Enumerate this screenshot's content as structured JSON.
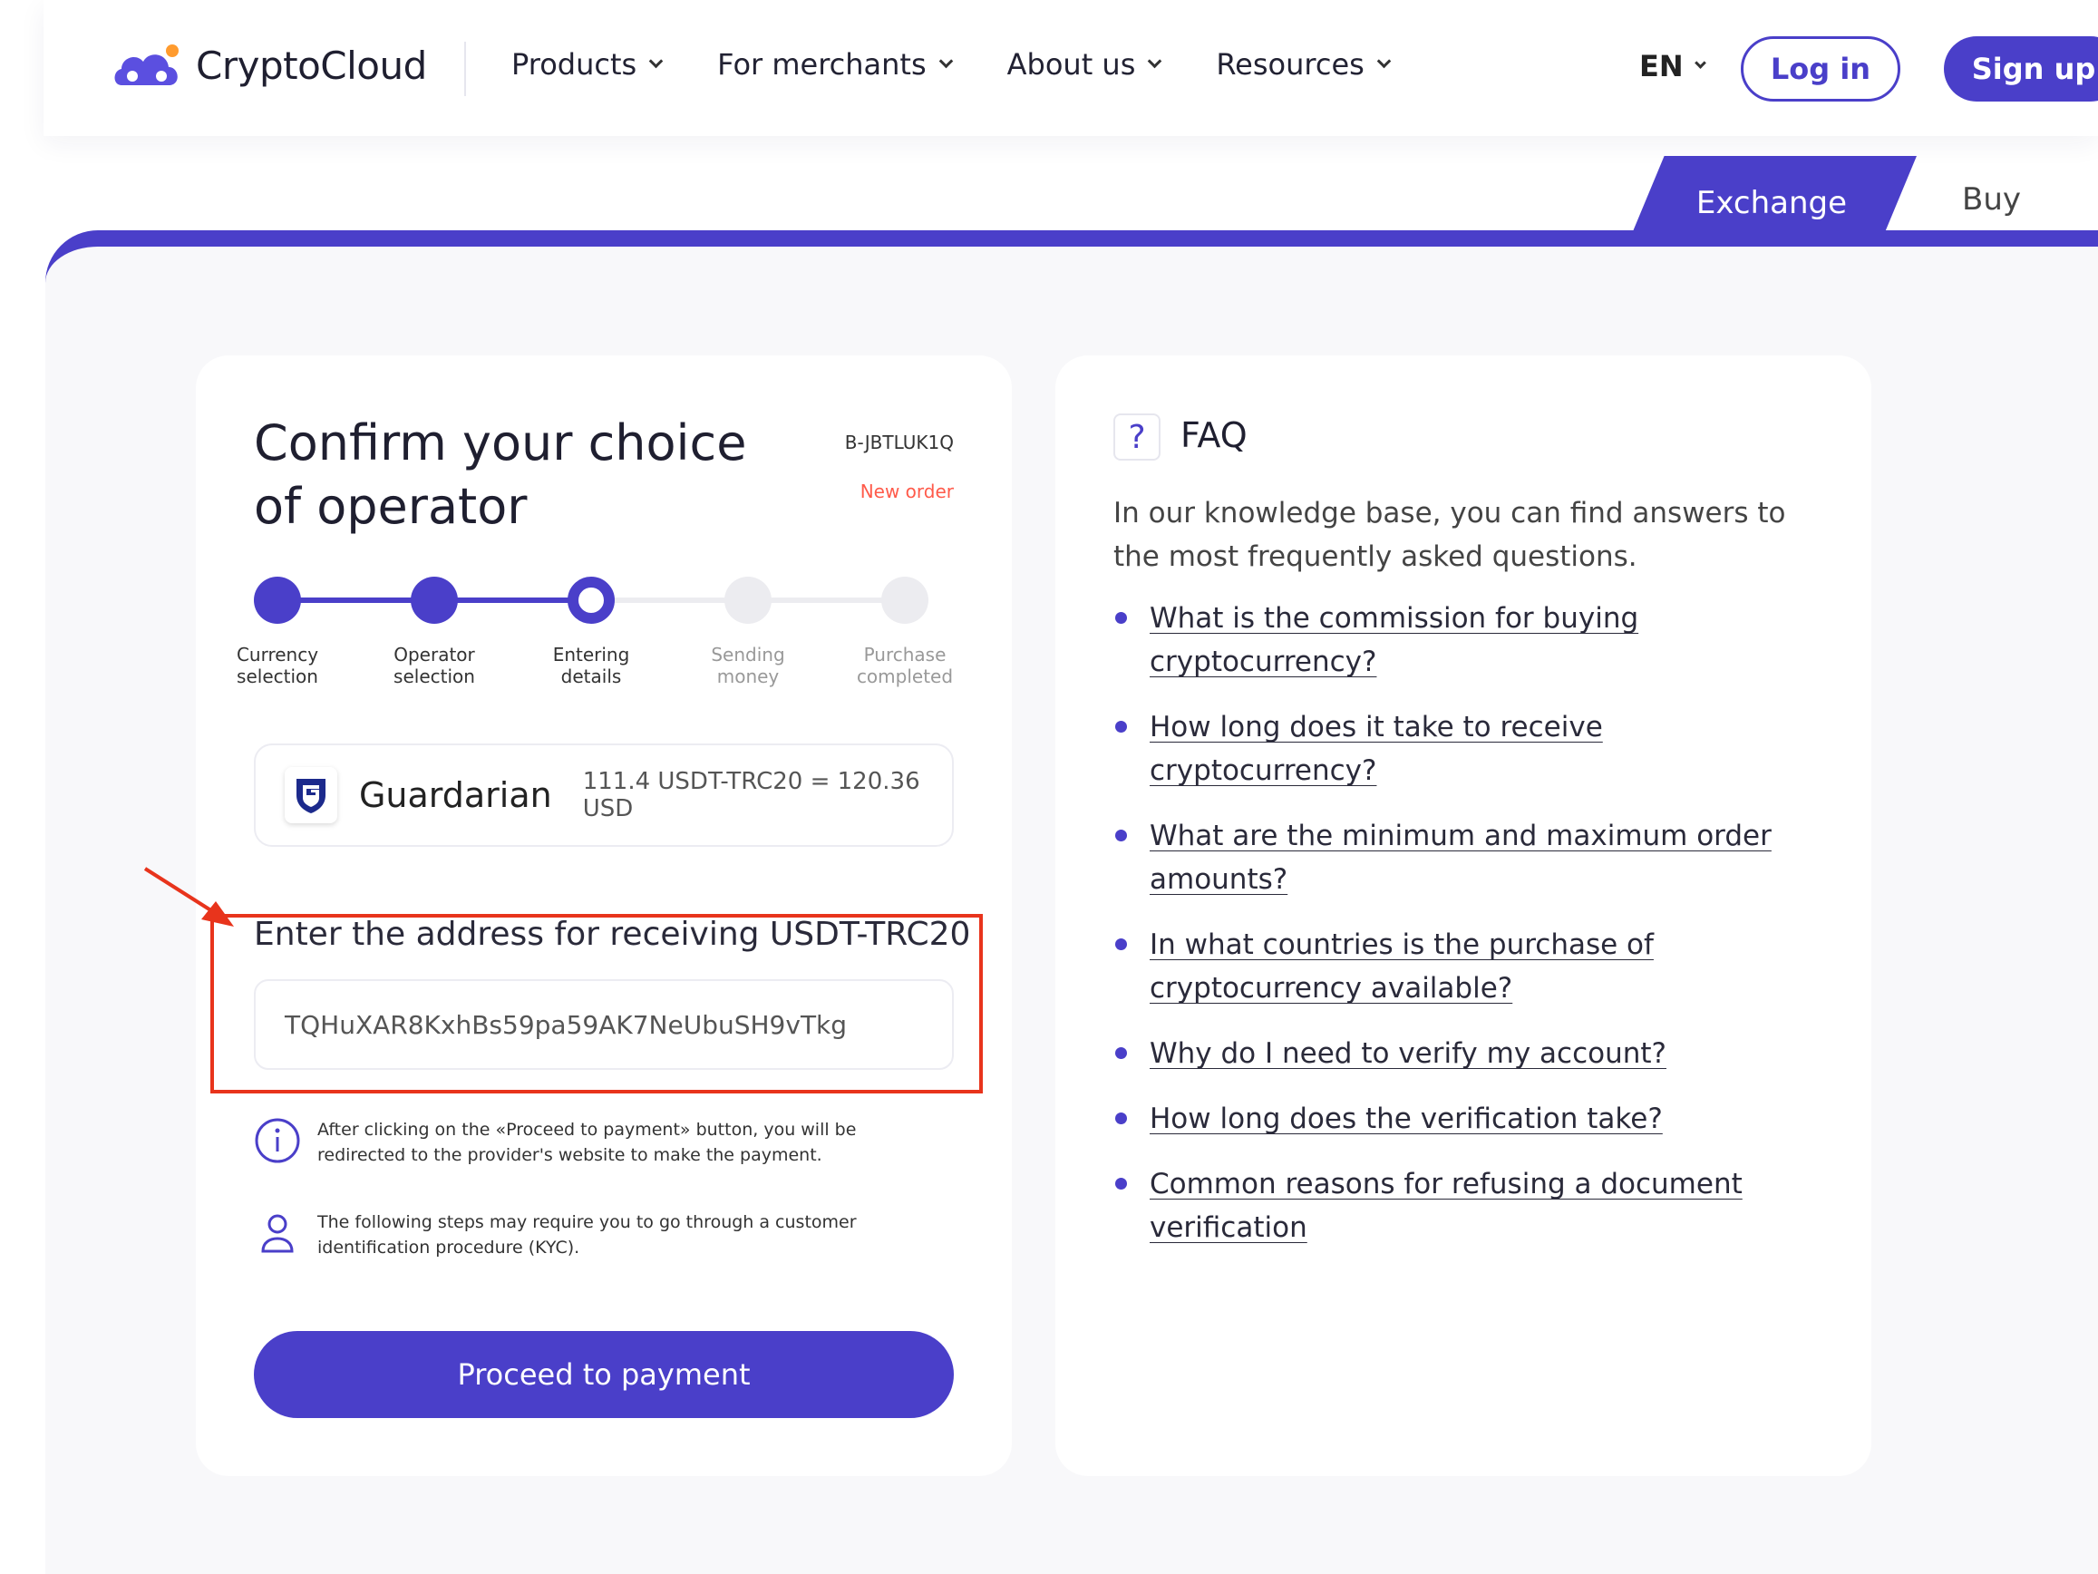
{
  "brand": {
    "name": "CryptoCloud",
    "accent": "#4a3fc9"
  },
  "nav": {
    "items": [
      {
        "label": "Products"
      },
      {
        "label": "For merchants"
      },
      {
        "label": "About us"
      },
      {
        "label": "Resources"
      }
    ],
    "language": "EN",
    "login_label": "Log in",
    "signup_label": "Sign up"
  },
  "tabs": {
    "exchange": "Exchange",
    "buy": "Buy"
  },
  "order": {
    "title": "Confirm your choice of operator",
    "id": "B-JBTLUK1Q",
    "new_order_label": "New order"
  },
  "steps": [
    {
      "label": "Currency selection",
      "state": "done"
    },
    {
      "label": "Operator selection",
      "state": "done"
    },
    {
      "label": "Entering details",
      "state": "current"
    },
    {
      "label": "Sending money",
      "state": "pending"
    },
    {
      "label": "Purchase completed",
      "state": "pending"
    }
  ],
  "operator": {
    "name": "Guardarian",
    "rate": "111.4 USDT-TRC20 = 120.36 USD",
    "icon": "guardarian-shield-icon"
  },
  "address": {
    "label": "Enter the address for receiving USDT-TRC20",
    "value": "TQHuXAR8KxhBs59pa59AK7NeUbuSH9vTkg"
  },
  "notes": {
    "redirect": "After clicking on the «Proceed to payment» button, you will be redirected to the provider's website to make the payment.",
    "kyc": "The following steps may require you to go through a customer identification procedure (KYC)."
  },
  "proceed_label": "Proceed to payment",
  "faq": {
    "title": "FAQ",
    "intro": "In our knowledge base, you can find answers to the most frequently asked questions.",
    "items": [
      "What is the commission for buying cryptocurrency?",
      "How long does it take to receive cryptocurrency?",
      "What are the minimum and maximum order amounts?",
      "In what countries is the purchase of cryptocurrency available?",
      "Why do I need to verify my account?",
      "How long does the verification take?",
      "Common reasons for refusing a document verification"
    ]
  },
  "annotation_color": "#e8341c"
}
